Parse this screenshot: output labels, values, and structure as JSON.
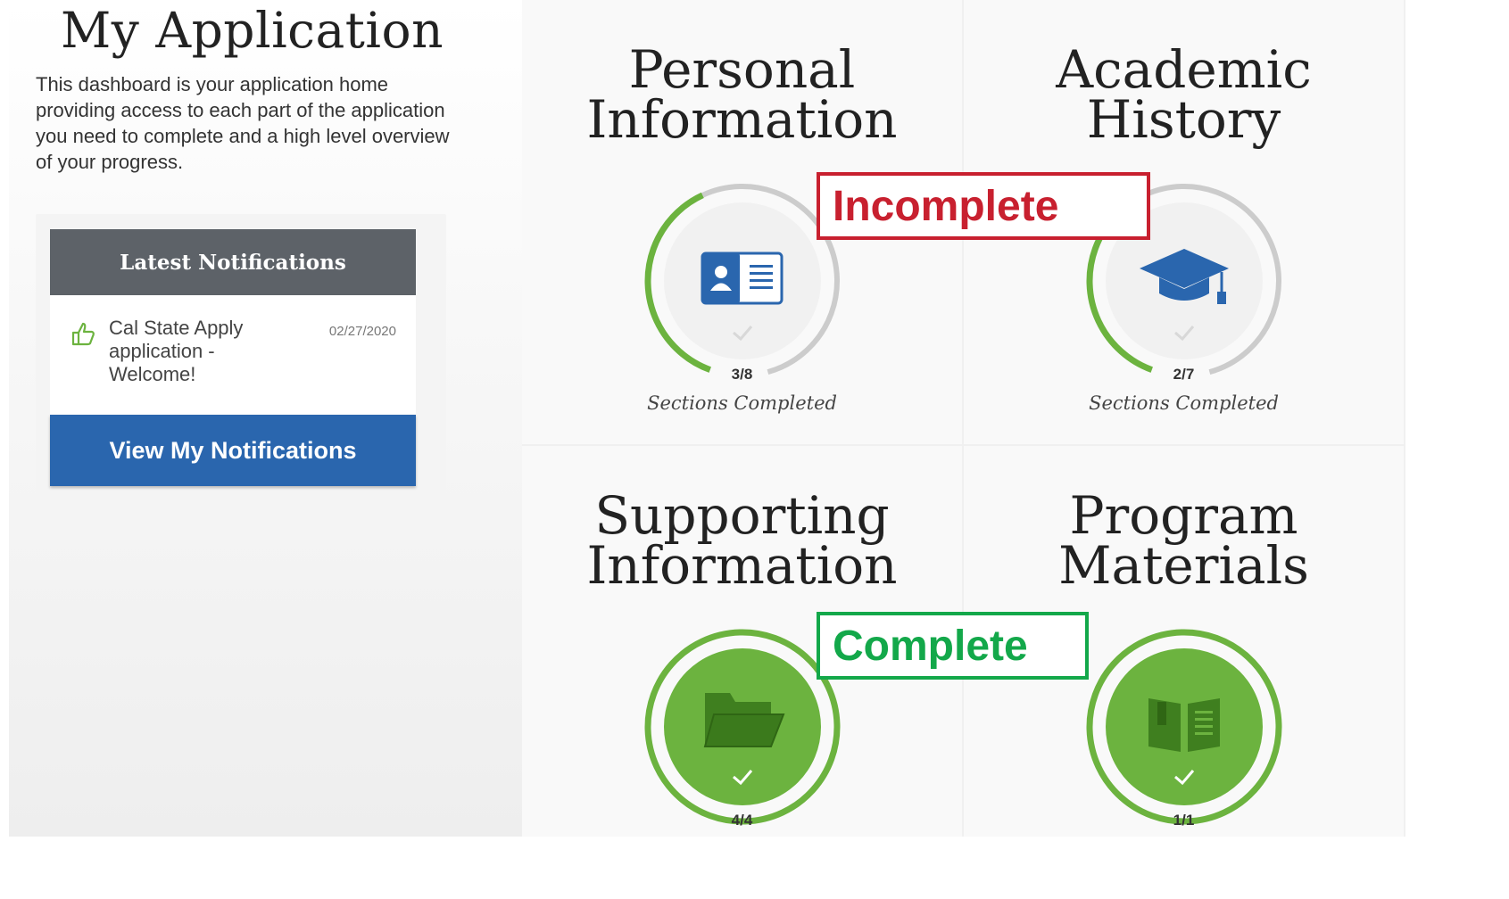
{
  "page": {
    "title": "My Application",
    "intro": "This dashboard is your application home providing access to each part of the application you need to complete and a high level overview of your progress."
  },
  "notifications": {
    "header": "Latest Notifications",
    "item": {
      "message": "Cal State Apply application - Welcome!",
      "date": "02/27/2020"
    },
    "view_button": "View My Notifications"
  },
  "tiles": [
    {
      "title_line1": "Personal",
      "title_line2": "Information",
      "count": "3/8",
      "completed": 3,
      "total": 8,
      "label": "Sections Completed",
      "icon": "id-card-icon",
      "status": "incomplete"
    },
    {
      "title_line1": "Academic",
      "title_line2": "History",
      "count": "2/7",
      "completed": 2,
      "total": 7,
      "label": "Sections Completed",
      "icon": "graduation-cap-icon",
      "status": "incomplete"
    },
    {
      "title_line1": "Supporting",
      "title_line2": "Information",
      "count": "4/4",
      "completed": 4,
      "total": 4,
      "label": "",
      "icon": "folder-icon",
      "status": "complete"
    },
    {
      "title_line1": "Program",
      "title_line2": "Materials",
      "count": "1/1",
      "completed": 1,
      "total": 1,
      "label": "",
      "icon": "book-icon",
      "status": "complete"
    }
  ],
  "annotations": {
    "incomplete": "Incomplete",
    "complete": "Complete"
  },
  "colors": {
    "green": "#6cb33f",
    "dark_green": "#3f7f1f",
    "blue": "#2a66ae",
    "red": "#c8202f",
    "callout_green": "#13a84a",
    "grey_ring": "#cccccc"
  }
}
